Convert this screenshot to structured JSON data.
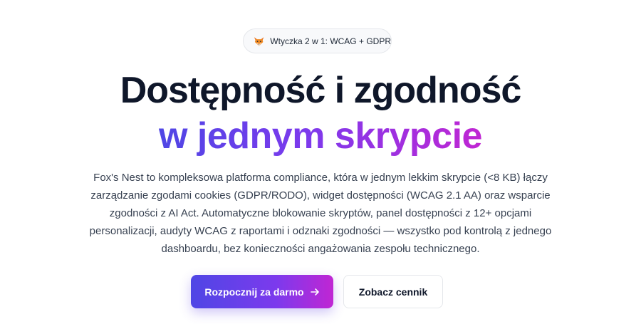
{
  "badge": {
    "icon": "fox-icon",
    "text": "Wtyczka 2 w 1: WCAG + GDPR"
  },
  "hero": {
    "title_line1": "Dostępność i zgodność",
    "title_line2": "w jednym skrypcie",
    "description": "Fox's Nest to kompleksowa platforma compliance, która w jednym lekkim skrypcie (<8 KB) łączy zarządzanie zgodami cookies (GDPR/RODO), widget dostępności (WCAG 2.1 AA) oraz wsparcie zgodności z AI Act. Automatyczne blokowanie skryptów, panel dostępności z 12+ opcjami personalizacji, audyty WCAG z raportami i odznaki zgodności — wszystko pod kontrolą z jednego dashboardu, bez konieczności angażowania zespołu technicznego."
  },
  "actions": {
    "primary_label": "Rozpocznij za darmo",
    "primary_icon": "arrow-right-icon",
    "secondary_label": "Zobacz cennik"
  },
  "colors": {
    "gradient_start": "#4f46e5",
    "gradient_mid": "#7c3aed",
    "gradient_end": "#c026d3",
    "heading": "#0f172a"
  }
}
